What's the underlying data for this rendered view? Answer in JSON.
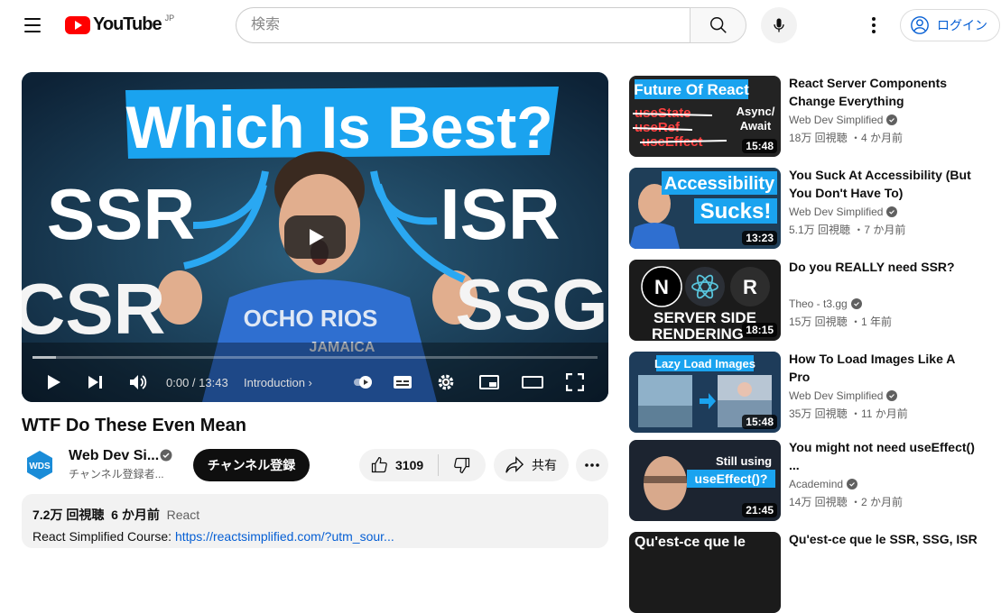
{
  "header": {
    "logo_text": "YouTube",
    "country_code": "JP",
    "search_placeholder": "検索",
    "login_label": "ログイン"
  },
  "player": {
    "thumb_title": "Which Is Best?",
    "thumb_labels": [
      "SSR",
      "ISR",
      "CSR",
      "SSG"
    ],
    "shirt_text": "OCHO RIOS",
    "shirt_text2": "JAMAICA",
    "time": "0:00 / 13:43",
    "chapter": "Introduction"
  },
  "video": {
    "title": "WTF Do These Even Mean",
    "channel_name": "Web Dev Si...",
    "channel_avatar_text": "WDS",
    "subscribers": "チャンネル登録者...",
    "subscribe_label": "チャンネル登録",
    "likes": "3109",
    "share_label": "共有",
    "views": "7.2万 回視聴",
    "age": "6 か月前",
    "tag": "React",
    "desc_prefix": "React Simplified Course: ",
    "desc_link": "https://reactsimplified.com/?utm_sour..."
  },
  "related": [
    {
      "title": "React Server Components Change Everything",
      "channel": "Web Dev Simplified",
      "meta": "18万 回視聴 ・4 か月前",
      "duration": "15:48",
      "thumb_top": "Future Of React",
      "thumb_l1": "useState",
      "thumb_l2": "useRef",
      "thumb_l3": "useEffect",
      "thumb_r1": "Async/",
      "thumb_r2": "Await"
    },
    {
      "title": "You Suck At Accessibility (But You Don't Have To)",
      "channel": "Web Dev Simplified",
      "meta": "5.1万 回視聴 ・7 か月前",
      "duration": "13:23",
      "thumb_top": "Accessibility",
      "thumb_l1": "Sucks!"
    },
    {
      "title": "Do you REALLY need SSR?",
      "channel": "Theo - t3.gg",
      "meta": "15万 回視聴 ・1 年前",
      "duration": "18:15",
      "thumb_top": "SERVER SIDE",
      "thumb_l1": "RENDERING"
    },
    {
      "title": "How To Load Images Like A Pro",
      "channel": "Web Dev Simplified",
      "meta": "35万 回視聴 ・11 か月前",
      "duration": "15:48",
      "thumb_top": "Lazy Load Images"
    },
    {
      "title": "You might not need useEffect() ...",
      "channel": "Academind",
      "meta": "14万 回視聴 ・2 か月前",
      "duration": "21:45",
      "thumb_top": "Still using",
      "thumb_l1": "useEffect()?"
    },
    {
      "title": "Qu'est-ce que le SSR, SSG, ISR",
      "channel": "",
      "meta": "",
      "duration": "",
      "thumb_top": "Qu'est-ce que le"
    }
  ]
}
